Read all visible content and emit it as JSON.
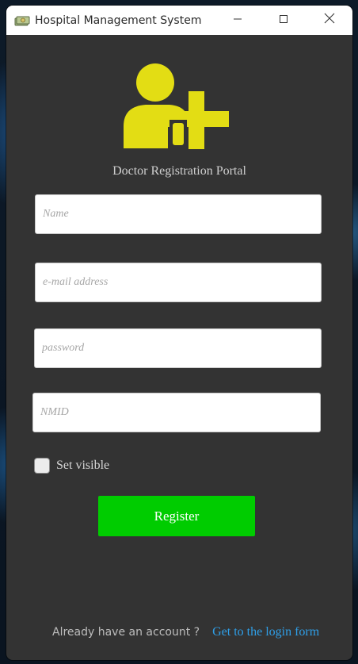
{
  "window": {
    "title": "Hospital Management System",
    "app_icon": "money-stack-icon",
    "controls": {
      "minimize_icon": "minimize-icon",
      "maximize_icon": "maximize-icon",
      "close_icon": "close-icon"
    }
  },
  "header": {
    "logo_icon": "add-user-icon",
    "portal_title": "Doctor Registration Portal"
  },
  "form": {
    "name_placeholder": "Name",
    "email_placeholder": "e-mail address",
    "password_placeholder": "password",
    "nmid_placeholder": "NMID",
    "name_value": "",
    "email_value": "",
    "password_value": "",
    "nmid_value": "",
    "set_visible_label": "Set visible",
    "set_visible_checked": false,
    "register_label": "Register"
  },
  "footer": {
    "prompt": "Already have an account ?",
    "login_link": "Get to the login form"
  },
  "colors": {
    "panel_bg": "#333333",
    "logo_yellow": "#e3dd14",
    "register_green": "#00cc00",
    "link_blue": "#2f9fe8"
  }
}
